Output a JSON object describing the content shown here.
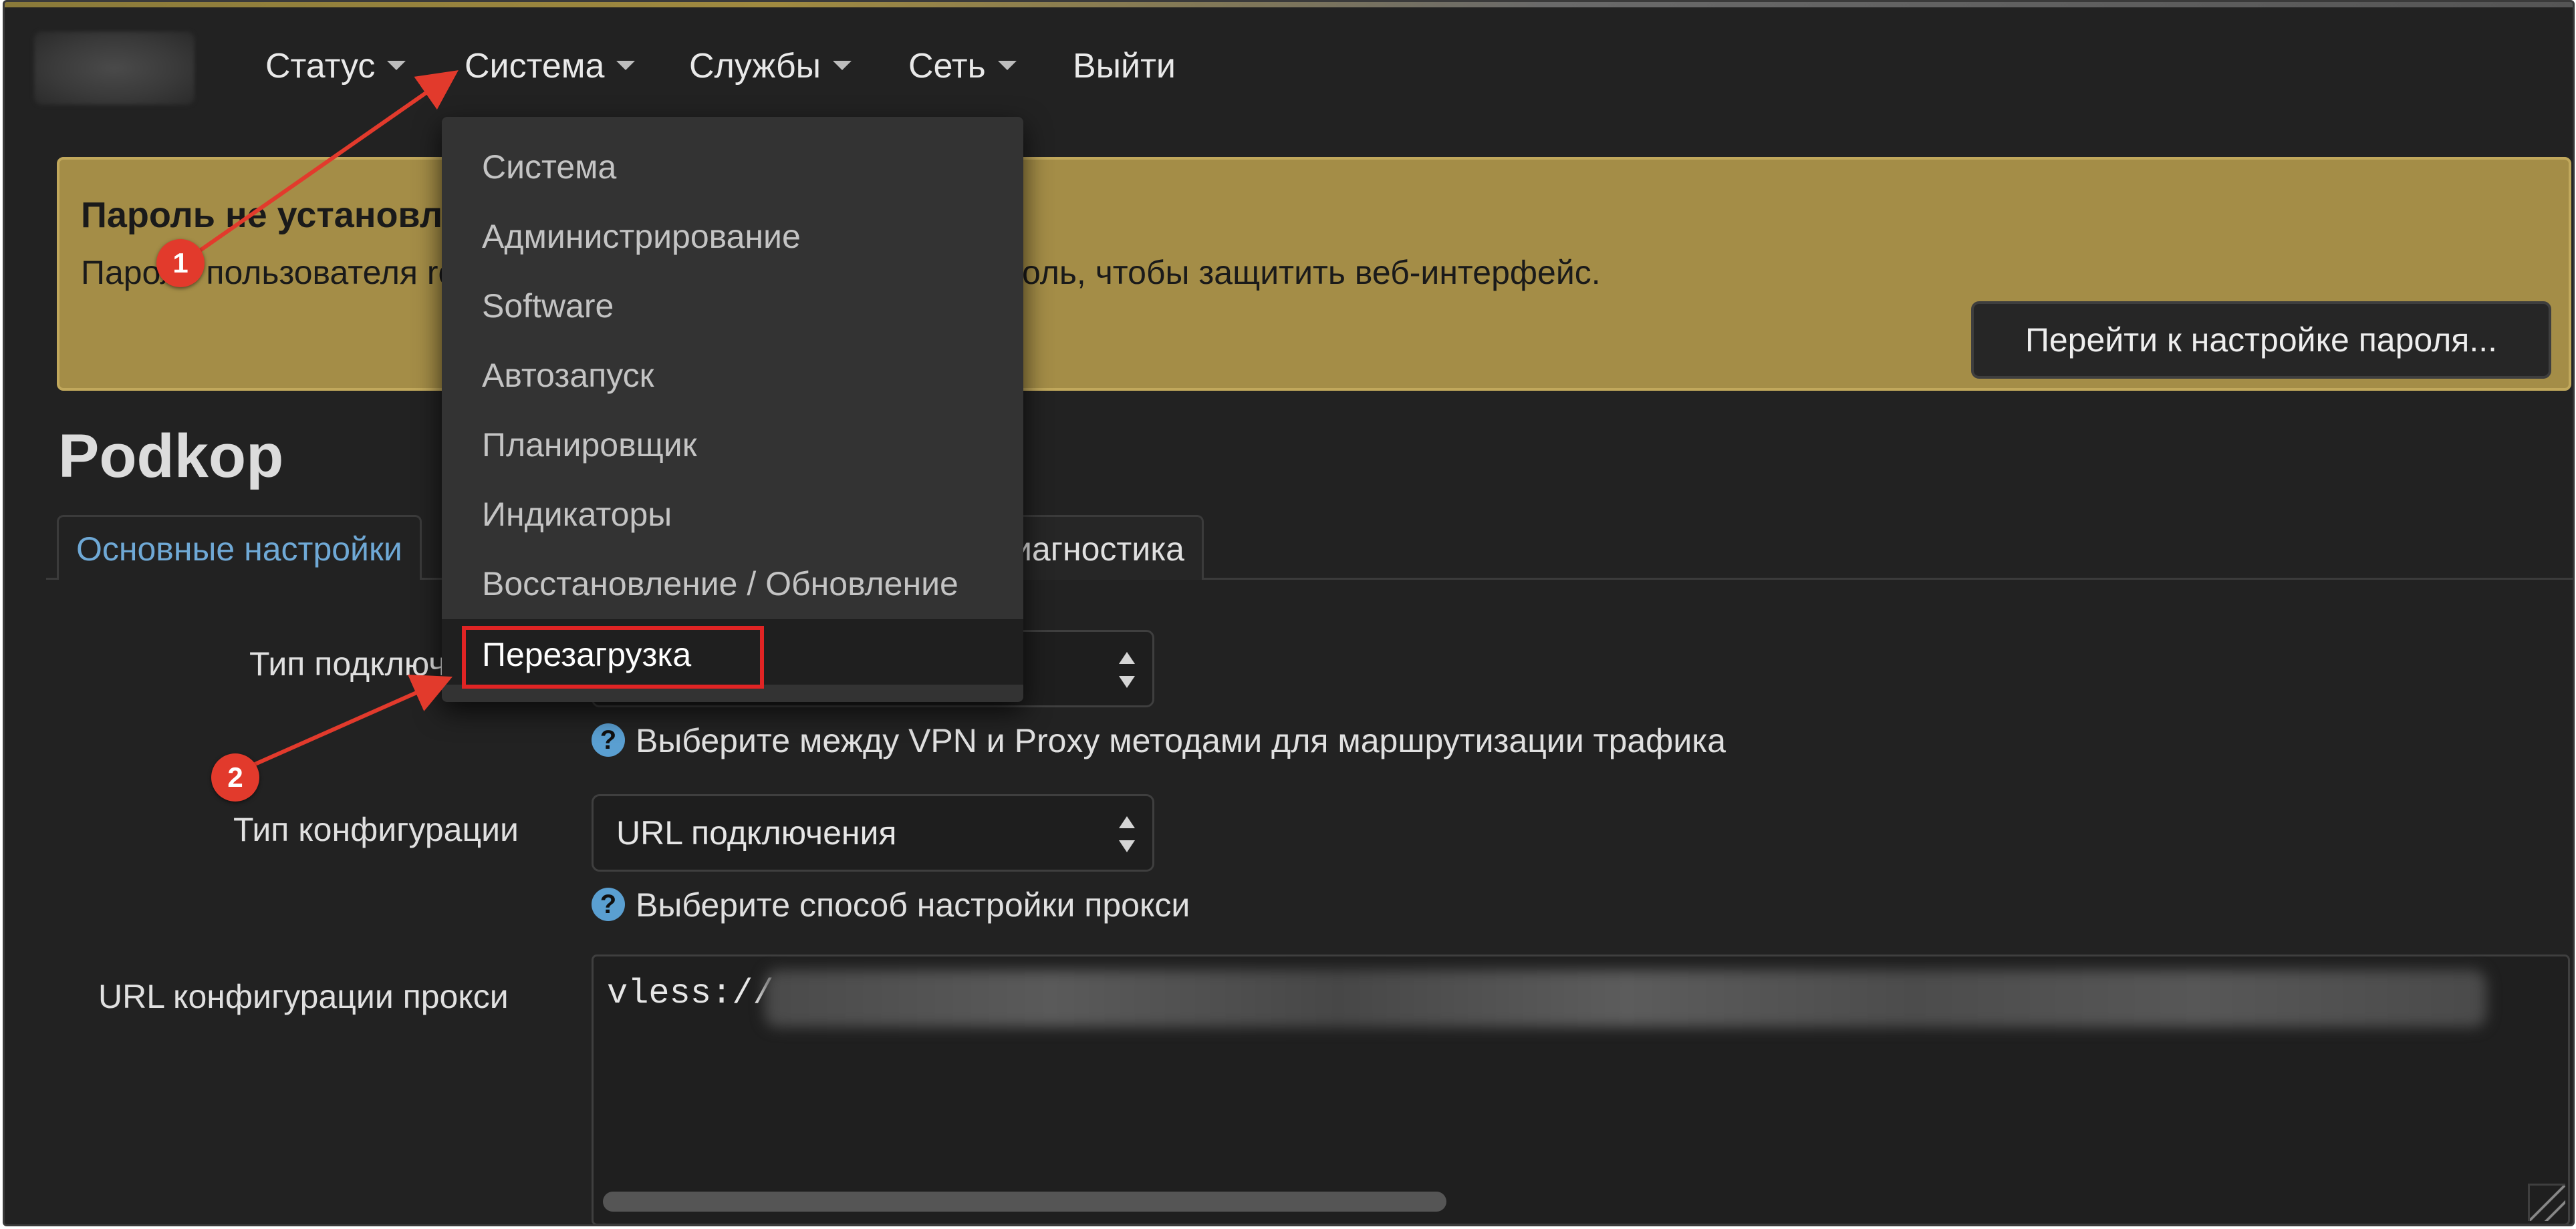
{
  "nav": {
    "items": [
      {
        "label": "Статус",
        "has_caret": true
      },
      {
        "label": "Система",
        "has_caret": true
      },
      {
        "label": "Службы",
        "has_caret": true
      },
      {
        "label": "Сеть",
        "has_caret": true
      },
      {
        "label": "Выйти",
        "has_caret": false
      }
    ],
    "caret_icon": "caret-down-icon"
  },
  "alert": {
    "title": "Пароль не установлен!",
    "text_left": "Пароль пользователя root не установлен.",
    "text_right": "оль, чтобы защитить веб-интерфейс.",
    "button_label": "Перейти к настройке пароля...",
    "bg_color": "#a48d47"
  },
  "page": {
    "title": "Podkop"
  },
  "tabs": {
    "active": "Основные настройки",
    "diagnostics": "Диагностика"
  },
  "dropdown": {
    "items": [
      "Система",
      "Администрирование",
      "Software",
      "Автозапуск",
      "Планировщик",
      "Индикаторы",
      "Восстановление / Обновление",
      "Перезагрузка"
    ],
    "highlighted": "Перезагрузка"
  },
  "form": {
    "connection_type": {
      "label": "Тип подключения",
      "help": "Выберите между VPN и Proxy методами для маршрутизации трафика"
    },
    "config_type": {
      "label": "Тип конфигурации",
      "value": "URL подключения",
      "help": "Выберите способ настройки прокси"
    },
    "proxy_url": {
      "label": "URL конфигурации прокси",
      "value_prefix": "vless://"
    },
    "help_icon": "question-circle-icon"
  },
  "annotations": [
    {
      "number": "1",
      "color": "#e23a2c"
    },
    {
      "number": "2",
      "color": "#e23a2c"
    }
  ]
}
